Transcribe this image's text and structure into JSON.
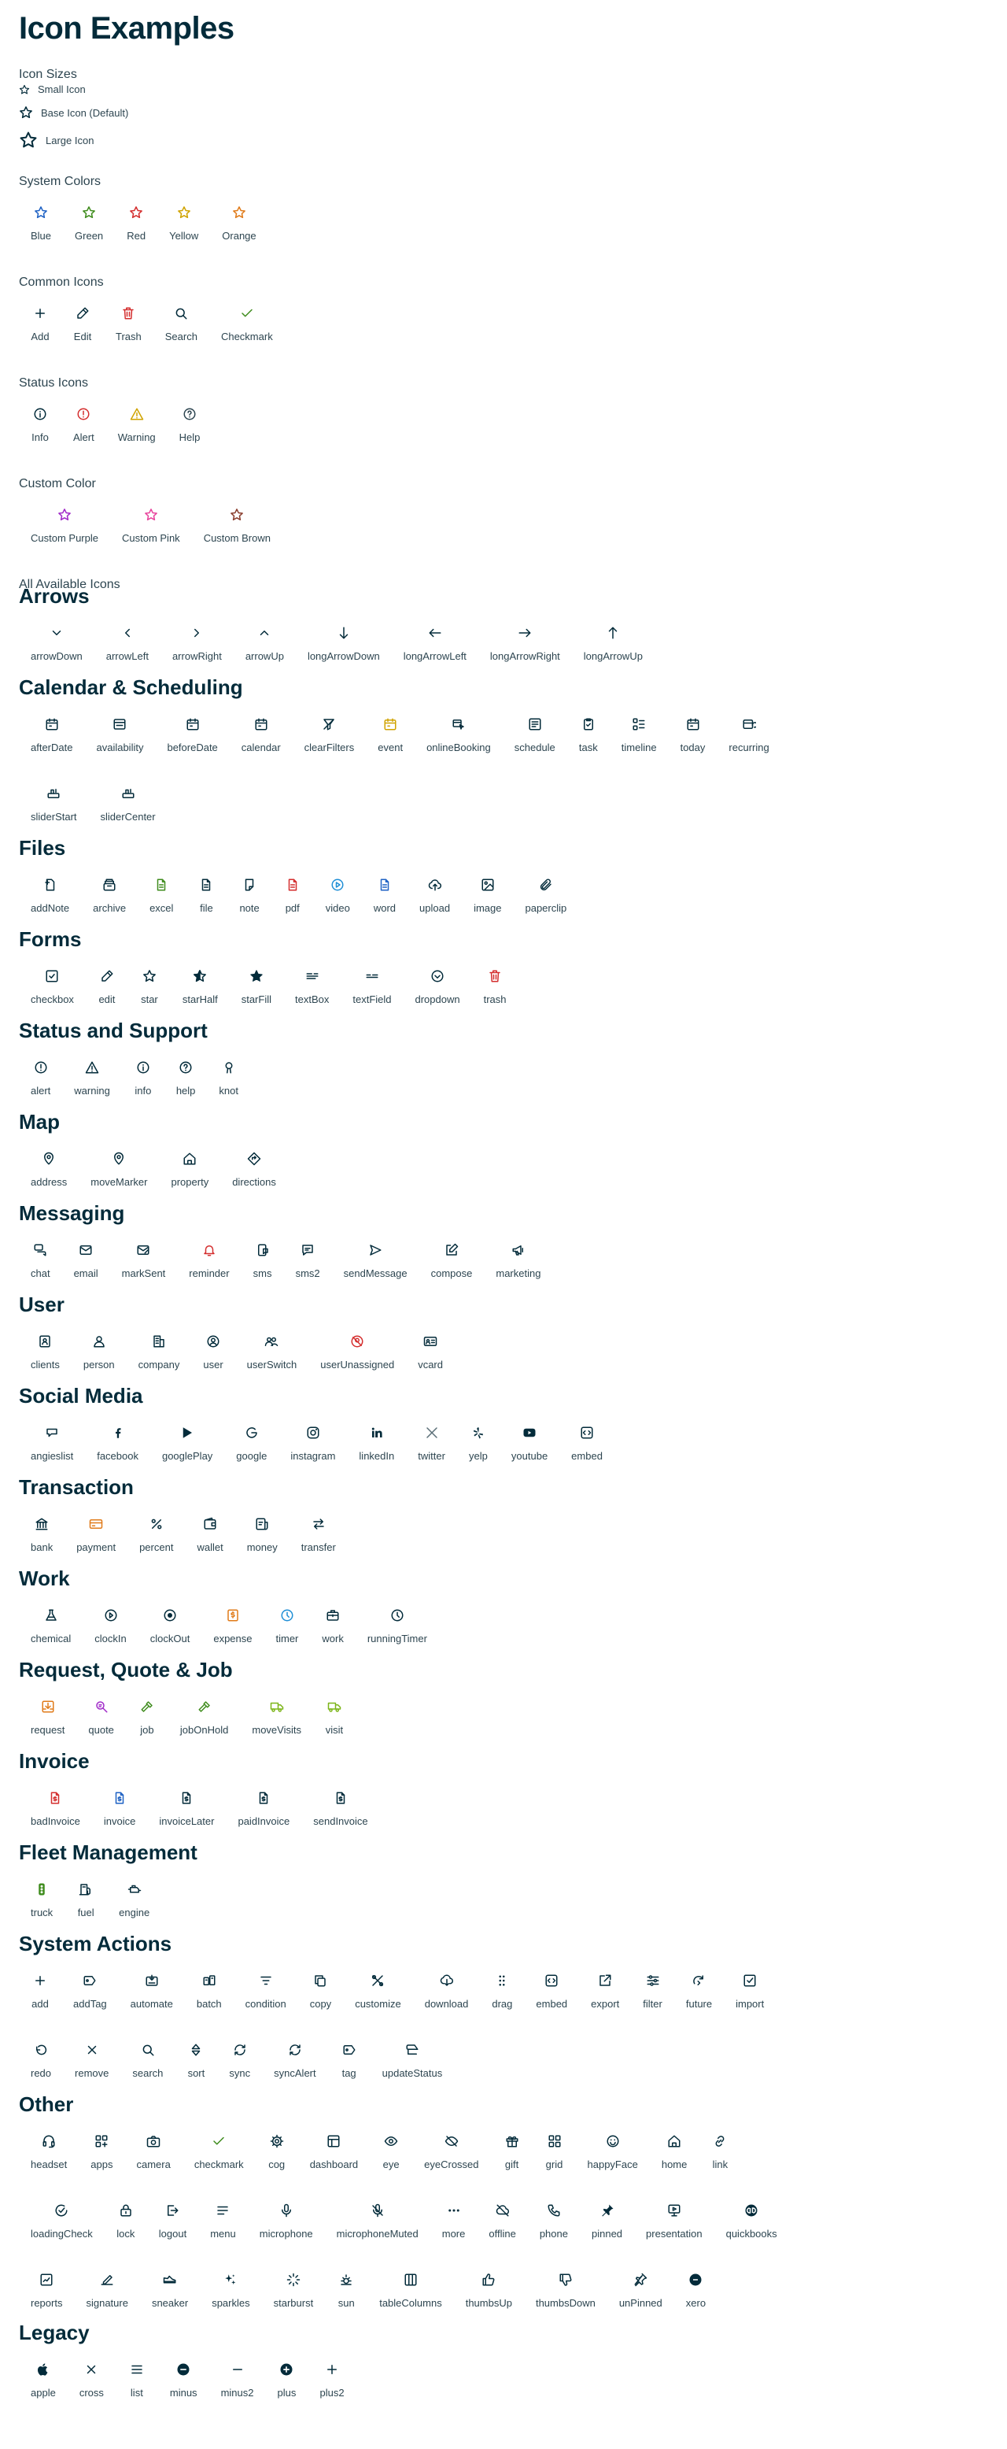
{
  "title": "Icon Examples",
  "sizes": {
    "heading": "Icon Sizes",
    "small": "Small Icon",
    "base": "Base Icon (Default)",
    "large": "Large Icon"
  },
  "system_colors": {
    "heading": "System Colors",
    "items": [
      {
        "label": "Blue",
        "color": "#1f62c4"
      },
      {
        "label": "Green",
        "color": "#3f8c1d"
      },
      {
        "label": "Red",
        "color": "#d42e2e"
      },
      {
        "label": "Yellow",
        "color": "#d0a300"
      },
      {
        "label": "Orange",
        "color": "#e07b1a"
      }
    ]
  },
  "common_icons": {
    "heading": "Common Icons",
    "items": [
      {
        "label": "Add",
        "icon": "add-icon",
        "color": "#032b3a"
      },
      {
        "label": "Edit",
        "icon": "edit-icon",
        "color": "#032b3a"
      },
      {
        "label": "Trash",
        "icon": "trash-icon",
        "color": "#d42e2e"
      },
      {
        "label": "Search",
        "icon": "search-icon",
        "color": "#032b3a"
      },
      {
        "label": "Checkmark",
        "icon": "checkmark-icon",
        "color": "#3f8c1d"
      }
    ]
  },
  "status_icons": {
    "heading": "Status Icons",
    "items": [
      {
        "label": "Info",
        "icon": "info-icon",
        "color": "#032b3a"
      },
      {
        "label": "Alert",
        "icon": "alert-icon",
        "color": "#d42e2e"
      },
      {
        "label": "Warning",
        "icon": "warning-icon",
        "color": "#d0a300"
      },
      {
        "label": "Help",
        "icon": "help-icon",
        "color": "#2d4550"
      }
    ]
  },
  "custom_color": {
    "heading": "Custom Color",
    "items": [
      {
        "label": "Custom Purple",
        "color": "#a12bc9"
      },
      {
        "label": "Custom Pink",
        "color": "#e8459d"
      },
      {
        "label": "Custom Brown",
        "color": "#8b3f2f"
      }
    ]
  },
  "all_heading": "All Available Icons",
  "sections": [
    {
      "title": "Arrows",
      "rows": [
        [
          {
            "label": "arrowDown",
            "icon": "arrowDown"
          },
          {
            "label": "arrowLeft",
            "icon": "arrowLeft"
          },
          {
            "label": "arrowRight",
            "icon": "arrowRight"
          },
          {
            "label": "arrowUp",
            "icon": "arrowUp"
          },
          {
            "label": "longArrowDown",
            "icon": "longArrowDown"
          },
          {
            "label": "longArrowLeft",
            "icon": "longArrowLeft"
          },
          {
            "label": "longArrowRight",
            "icon": "longArrowRight"
          },
          {
            "label": "longArrowUp",
            "icon": "longArrowUp"
          }
        ]
      ]
    },
    {
      "title": "Calendar & Scheduling",
      "rows": [
        [
          {
            "label": "afterDate",
            "icon": "calendar"
          },
          {
            "label": "availability",
            "icon": "availability"
          },
          {
            "label": "beforeDate",
            "icon": "calendar"
          },
          {
            "label": "calendar",
            "icon": "calendar"
          },
          {
            "label": "clearFilters",
            "icon": "clearFilters"
          },
          {
            "label": "event",
            "icon": "calendar",
            "color": "#d0a300"
          },
          {
            "label": "onlineBooking",
            "icon": "onlineBooking"
          },
          {
            "label": "schedule",
            "icon": "schedule"
          },
          {
            "label": "task",
            "icon": "task"
          },
          {
            "label": "timeline",
            "icon": "timeline"
          },
          {
            "label": "today",
            "icon": "calendar"
          },
          {
            "label": "recurring",
            "icon": "recurring"
          }
        ],
        [
          {
            "label": "sliderStart",
            "icon": "slider"
          },
          {
            "label": "sliderCenter",
            "icon": "slider"
          }
        ]
      ]
    },
    {
      "title": "Files",
      "rows": [
        [
          {
            "label": "addNote",
            "icon": "addNote"
          },
          {
            "label": "archive",
            "icon": "archive"
          },
          {
            "label": "excel",
            "icon": "file",
            "color": "#3f8c1d"
          },
          {
            "label": "file",
            "icon": "file"
          },
          {
            "label": "note",
            "icon": "note"
          },
          {
            "label": "pdf",
            "icon": "file",
            "color": "#d42e2e"
          },
          {
            "label": "video",
            "icon": "video",
            "color": "#1f8fd6"
          },
          {
            "label": "word",
            "icon": "file",
            "color": "#1f62c4"
          },
          {
            "label": "upload",
            "icon": "upload"
          },
          {
            "label": "image",
            "icon": "image"
          },
          {
            "label": "paperclip",
            "icon": "paperclip"
          }
        ]
      ]
    },
    {
      "title": "Forms",
      "rows": [
        [
          {
            "label": "checkbox",
            "icon": "checkbox"
          },
          {
            "label": "edit",
            "icon": "edit"
          },
          {
            "label": "star",
            "icon": "star"
          },
          {
            "label": "starHalf",
            "icon": "starHalf"
          },
          {
            "label": "starFill",
            "icon": "starFill"
          },
          {
            "label": "textBox",
            "icon": "textBox"
          },
          {
            "label": "textField",
            "icon": "textField"
          },
          {
            "label": "dropdown",
            "icon": "dropdown"
          },
          {
            "label": "trash",
            "icon": "trash",
            "color": "#d42e2e"
          }
        ]
      ]
    },
    {
      "title": "Status and Support",
      "rows": [
        [
          {
            "label": "alert",
            "icon": "alert"
          },
          {
            "label": "warning",
            "icon": "warning"
          },
          {
            "label": "info",
            "icon": "info"
          },
          {
            "label": "help",
            "icon": "help"
          },
          {
            "label": "knot",
            "icon": "knot"
          }
        ]
      ]
    },
    {
      "title": "Map",
      "rows": [
        [
          {
            "label": "address",
            "icon": "pin"
          },
          {
            "label": "moveMarker",
            "icon": "pin"
          },
          {
            "label": "property",
            "icon": "home"
          },
          {
            "label": "directions",
            "icon": "directions"
          }
        ]
      ]
    },
    {
      "title": "Messaging",
      "rows": [
        [
          {
            "label": "chat",
            "icon": "chat"
          },
          {
            "label": "email",
            "icon": "email"
          },
          {
            "label": "markSent",
            "icon": "markSent"
          },
          {
            "label": "reminder",
            "icon": "bell",
            "color": "#d42e2e"
          },
          {
            "label": "sms",
            "icon": "sms"
          },
          {
            "label": "sms2",
            "icon": "sms2"
          },
          {
            "label": "sendMessage",
            "icon": "send"
          },
          {
            "label": "compose",
            "icon": "compose"
          },
          {
            "label": "marketing",
            "icon": "megaphone"
          }
        ]
      ]
    },
    {
      "title": "User",
      "rows": [
        [
          {
            "label": "clients",
            "icon": "clients"
          },
          {
            "label": "person",
            "icon": "person"
          },
          {
            "label": "company",
            "icon": "company"
          },
          {
            "label": "user",
            "icon": "user"
          },
          {
            "label": "userSwitch",
            "icon": "userSwitch"
          },
          {
            "label": "userUnassigned",
            "icon": "userUnassigned",
            "color": "#d42e2e"
          },
          {
            "label": "vcard",
            "icon": "vcard"
          }
        ]
      ]
    },
    {
      "title": "Social Media",
      "rows": [
        [
          {
            "label": "angieslist",
            "icon": "angieslist"
          },
          {
            "label": "facebook",
            "icon": "facebook"
          },
          {
            "label": "googlePlay",
            "icon": "googlePlay"
          },
          {
            "label": "google",
            "icon": "google"
          },
          {
            "label": "instagram",
            "icon": "instagram"
          },
          {
            "label": "linkedIn",
            "icon": "linkedIn"
          },
          {
            "label": "twitter",
            "icon": "twitter",
            "color": "#5a6e77"
          },
          {
            "label": "yelp",
            "icon": "yelp"
          },
          {
            "label": "youtube",
            "icon": "youtube"
          },
          {
            "label": "embed",
            "icon": "embed"
          }
        ]
      ]
    },
    {
      "title": "Transaction",
      "rows": [
        [
          {
            "label": "bank",
            "icon": "bank"
          },
          {
            "label": "payment",
            "icon": "payment",
            "color": "#e07b1a"
          },
          {
            "label": "percent",
            "icon": "percent"
          },
          {
            "label": "wallet",
            "icon": "wallet"
          },
          {
            "label": "money",
            "icon": "money"
          },
          {
            "label": "transfer",
            "icon": "transfer"
          }
        ]
      ]
    },
    {
      "title": "Work",
      "rows": [
        [
          {
            "label": "chemical",
            "icon": "chemical"
          },
          {
            "label": "clockIn",
            "icon": "clockIn"
          },
          {
            "label": "clockOut",
            "icon": "clockOut"
          },
          {
            "label": "expense",
            "icon": "expense",
            "color": "#e07b1a"
          },
          {
            "label": "timer",
            "icon": "clock",
            "color": "#1f8fd6"
          },
          {
            "label": "work",
            "icon": "work"
          },
          {
            "label": "runningTimer",
            "icon": "clock"
          }
        ]
      ]
    },
    {
      "title": "Request, Quote & Job",
      "rows": [
        [
          {
            "label": "request",
            "icon": "request",
            "color": "#e07b1a"
          },
          {
            "label": "quote",
            "icon": "quote",
            "color": "#a12bc9"
          },
          {
            "label": "job",
            "icon": "hammer",
            "color": "#3f8c1d"
          },
          {
            "label": "jobOnHold",
            "icon": "hammer",
            "color": "#3f8c1d"
          },
          {
            "label": "moveVisits",
            "icon": "truck",
            "color": "#7cb518"
          },
          {
            "label": "visit",
            "icon": "truck",
            "color": "#7cb518"
          }
        ]
      ]
    },
    {
      "title": "Invoice",
      "rows": [
        [
          {
            "label": "badInvoice",
            "icon": "invoice",
            "color": "#d42e2e"
          },
          {
            "label": "invoice",
            "icon": "invoice",
            "color": "#1f62c4"
          },
          {
            "label": "invoiceLater",
            "icon": "invoice"
          },
          {
            "label": "paidInvoice",
            "icon": "invoice"
          },
          {
            "label": "sendInvoice",
            "icon": "invoice"
          }
        ]
      ]
    },
    {
      "title": "Fleet Management",
      "rows": [
        [
          {
            "label": "truck",
            "icon": "trafficLight",
            "color": "#3f8c1d"
          },
          {
            "label": "fuel",
            "icon": "fuel"
          },
          {
            "label": "engine",
            "icon": "engine"
          }
        ]
      ]
    },
    {
      "title": "System Actions",
      "rows": [
        [
          {
            "label": "add",
            "icon": "add"
          },
          {
            "label": "addTag",
            "icon": "tag"
          },
          {
            "label": "automate",
            "icon": "automate"
          },
          {
            "label": "batch",
            "icon": "batch"
          },
          {
            "label": "condition",
            "icon": "condition"
          },
          {
            "label": "copy",
            "icon": "copy"
          },
          {
            "label": "customize",
            "icon": "customize"
          },
          {
            "label": "download",
            "icon": "download"
          },
          {
            "label": "drag",
            "icon": "drag"
          },
          {
            "label": "embed",
            "icon": "embed"
          },
          {
            "label": "export",
            "icon": "export"
          },
          {
            "label": "filter",
            "icon": "filter"
          },
          {
            "label": "future",
            "icon": "future"
          },
          {
            "label": "import",
            "icon": "import"
          }
        ],
        [
          {
            "label": "redo",
            "icon": "redo"
          },
          {
            "label": "remove",
            "icon": "cross"
          },
          {
            "label": "search",
            "icon": "search"
          },
          {
            "label": "sort",
            "icon": "sort"
          },
          {
            "label": "sync",
            "icon": "sync"
          },
          {
            "label": "syncAlert",
            "icon": "sync"
          },
          {
            "label": "tag",
            "icon": "tag"
          },
          {
            "label": "updateStatus",
            "icon": "updateStatus"
          }
        ]
      ]
    },
    {
      "title": "Other",
      "rows": [
        [
          {
            "label": "headset",
            "icon": "headset"
          },
          {
            "label": "apps",
            "icon": "apps"
          },
          {
            "label": "camera",
            "icon": "camera"
          },
          {
            "label": "checkmark",
            "icon": "checkmark",
            "color": "#3f8c1d"
          },
          {
            "label": "cog",
            "icon": "cog"
          },
          {
            "label": "dashboard",
            "icon": "dashboard"
          },
          {
            "label": "eye",
            "icon": "eye"
          },
          {
            "label": "eyeCrossed",
            "icon": "eyeCrossed"
          },
          {
            "label": "gift",
            "icon": "gift"
          },
          {
            "label": "grid",
            "icon": "grid"
          },
          {
            "label": "happyFace",
            "icon": "happyFace"
          },
          {
            "label": "home",
            "icon": "home"
          },
          {
            "label": "link",
            "icon": "link"
          }
        ],
        [
          {
            "label": "loadingCheck",
            "icon": "loadingCheck"
          },
          {
            "label": "lock",
            "icon": "lock"
          },
          {
            "label": "logout",
            "icon": "logout"
          },
          {
            "label": "menu",
            "icon": "menu"
          },
          {
            "label": "microphone",
            "icon": "microphone"
          },
          {
            "label": "microphoneMuted",
            "icon": "microphoneMuted"
          },
          {
            "label": "more",
            "icon": "more"
          },
          {
            "label": "offline",
            "icon": "offline"
          },
          {
            "label": "phone",
            "icon": "phone"
          },
          {
            "label": "pinned",
            "icon": "pinned"
          },
          {
            "label": "presentation",
            "icon": "presentation"
          },
          {
            "label": "quickbooks",
            "icon": "quickbooks"
          }
        ],
        [
          {
            "label": "reports",
            "icon": "reports"
          },
          {
            "label": "signature",
            "icon": "signature"
          },
          {
            "label": "sneaker",
            "icon": "sneaker"
          },
          {
            "label": "sparkles",
            "icon": "sparkles"
          },
          {
            "label": "starburst",
            "icon": "starburst"
          },
          {
            "label": "sun",
            "icon": "sun"
          },
          {
            "label": "tableColumns",
            "icon": "tableColumns"
          },
          {
            "label": "thumbsUp",
            "icon": "thumbsUp"
          },
          {
            "label": "thumbsDown",
            "icon": "thumbsDown"
          },
          {
            "label": "unPinned",
            "icon": "unPinned"
          },
          {
            "label": "xero",
            "icon": "xero"
          }
        ]
      ]
    },
    {
      "title": "Legacy",
      "rows": [
        [
          {
            "label": "apple",
            "icon": "apple"
          },
          {
            "label": "cross",
            "icon": "cross"
          },
          {
            "label": "list",
            "icon": "list"
          },
          {
            "label": "minus",
            "icon": "minusCircle"
          },
          {
            "label": "minus2",
            "icon": "minus"
          },
          {
            "label": "plus",
            "icon": "plusCircle"
          },
          {
            "label": "plus2",
            "icon": "add"
          }
        ]
      ]
    }
  ]
}
